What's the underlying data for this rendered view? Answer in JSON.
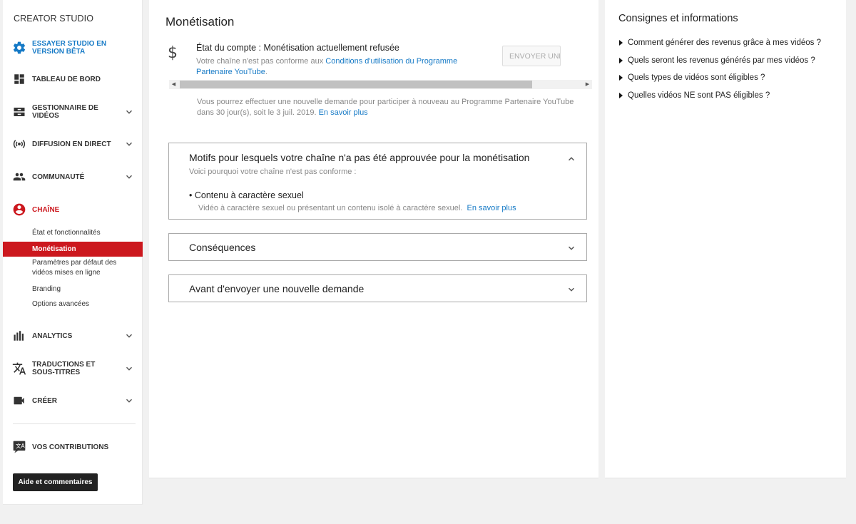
{
  "sidebar": {
    "brand": "CREATOR STUDIO",
    "items": [
      {
        "label": "ESSAYER STUDIO EN VERSION BÊTA",
        "icon": "gear-icon"
      },
      {
        "label": "TABLEAU DE BORD",
        "icon": "dashboard-icon"
      },
      {
        "label": "GESTIONNAIRE DE VIDÉOS",
        "icon": "video-manager-icon"
      },
      {
        "label": "DIFFUSION EN DIRECT",
        "icon": "live-broadcast-icon"
      },
      {
        "label": "COMMUNAUTÉ",
        "icon": "community-icon"
      },
      {
        "label": "CHAÎNE",
        "icon": "account-circle-icon"
      },
      {
        "label": "ANALYTICS",
        "icon": "analytics-icon"
      },
      {
        "label": "TRADUCTIONS ET SOUS-TITRES",
        "icon": "translate-icon"
      },
      {
        "label": "CRÉER",
        "icon": "camera-icon"
      },
      {
        "label": "VOS CONTRIBUTIONS",
        "icon": "translate-icon"
      }
    ],
    "channel_sub": [
      "État et fonctionnalités",
      "Monétisation",
      "Paramètres par défaut des vidéos mises en ligne",
      "Branding",
      "Options avancées"
    ],
    "help_button": "Aide et commentaires",
    "accent_color": "#cc181e",
    "beta_color": "#167ac6"
  },
  "main": {
    "title": "Monétisation",
    "status_title": "État du compte : Monétisation actuellement refusée",
    "status_desc_prefix": "Votre chaîne n'est pas conforme aux ",
    "status_desc_link": "Conditions d'utilisation du Programme Partenaire YouTube",
    "status_desc_suffix": ".",
    "send_button": "ENVOYER UNE NOUVE",
    "reapply_text": "Vous pourrez effectuer une nouvelle demande pour participer à nouveau au Programme Partenaire YouTube dans 30 jour(s), soit le 3 juil. 2019. ",
    "reapply_link": "En savoir plus",
    "panels": [
      {
        "title": "Motifs pour lesquels votre chaîne n'a pas été approuvée pour la monétisation",
        "subtitle": "Voici pourquoi votre chaîne n'est pas conforme :",
        "bullet_title": "Contenu à caractère sexuel",
        "bullet_desc": "Vidéo à caractère sexuel ou présentant un contenu isolé à caractère sexuel.",
        "bullet_link": "En savoir plus"
      },
      {
        "title": "Conséquences"
      },
      {
        "title": "Avant d'envoyer une nouvelle demande"
      }
    ]
  },
  "right": {
    "title": "Consignes et informations",
    "links": [
      "Comment générer des revenus grâce à mes vidéos ?",
      "Quels seront les revenus générés par mes vidéos ?",
      "Quels types de vidéos sont éligibles ?",
      "Quelles vidéos NE sont PAS éligibles ?"
    ]
  }
}
